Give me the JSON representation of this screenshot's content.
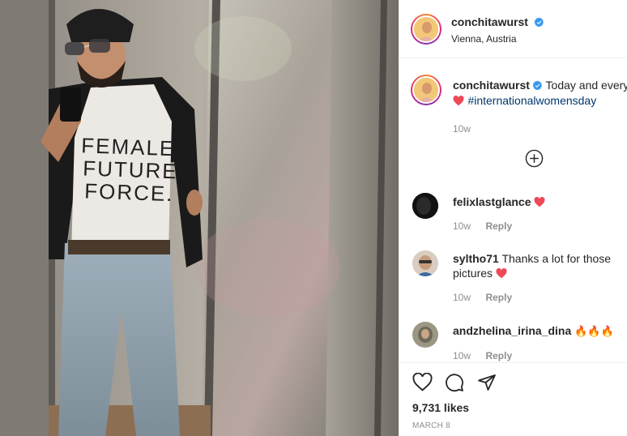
{
  "post": {
    "username": "conchitawurst",
    "location": "Vienna, Austria",
    "photo_shirt_lines": [
      "FEMALE",
      "FUTURE",
      "FORCE."
    ]
  },
  "caption": {
    "username": "conchitawurst",
    "text": "Today and every D",
    "hashtag": "#internationalwomensday",
    "time": "10w"
  },
  "load_more": {
    "icon": "plus-circle-icon"
  },
  "comments": [
    {
      "username": "felixlastglance",
      "text": "",
      "emoji": "heart",
      "time": "10w",
      "reply": "Reply",
      "avatar_color": "#1a1a1a"
    },
    {
      "username": "syltho71",
      "text": "Thanks a lot for those pictures",
      "emoji": "heart",
      "time": "10w",
      "reply": "Reply",
      "avatar_color": "#c9b8a8"
    },
    {
      "username": "andzhelina_irina_dina",
      "text": "",
      "emoji": "fire",
      "time": "10w",
      "reply": "Reply",
      "avatar_color": "#7d7a6e"
    }
  ],
  "actions": {
    "like_icon": "heart-outline-icon",
    "comment_icon": "comment-icon",
    "share_icon": "paper-plane-icon"
  },
  "likes": "9,731 likes",
  "date": "MARCH 8",
  "colors": {
    "verified": "#3897f0",
    "heart": "#ed4956",
    "hashtag": "#00376b",
    "muted": "#8e8e8e"
  }
}
